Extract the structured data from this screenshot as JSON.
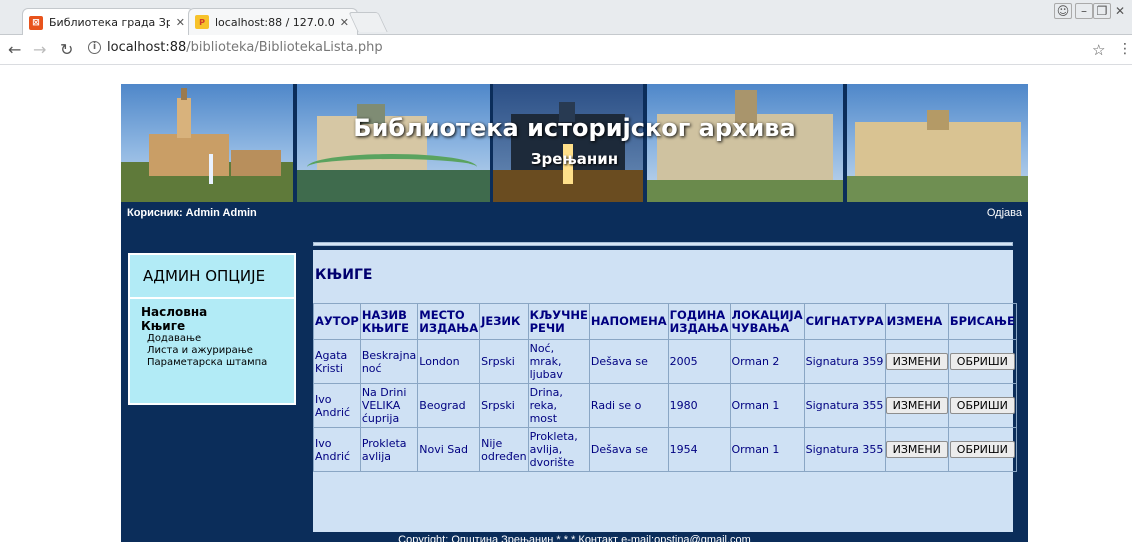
{
  "browser": {
    "tabs": [
      {
        "title": "Библиотека града Зрењ",
        "active": true
      },
      {
        "title": "localhost:88 / 127.0.0.1 /",
        "active": false
      }
    ],
    "url_host": "localhost:88",
    "url_path": "/biblioteka/BibliotekaLista.php"
  },
  "header": {
    "title": "Библиотека историјског архива",
    "subtitle": "Зрењанин"
  },
  "userbar": {
    "user": "Корисник: Admin Admin",
    "logout": "Одјава"
  },
  "sidebar": {
    "heading": "АДМИН ОПЦИЈЕ",
    "main_items": [
      "Насловна",
      "Књиге"
    ],
    "sub_items": [
      "Додавање",
      "Листа и ажурирање",
      "Параметарска штампа"
    ]
  },
  "content": {
    "title": "КЊИГЕ",
    "columns": [
      "АУТОР",
      "НАЗИВ КЊИГЕ",
      "МЕСТО ИЗДАЊА",
      "ЈЕЗИК",
      "КЉУЧНЕ РЕЧИ",
      "НАПОМЕНА",
      "ГОДИНА ИЗДАЊА",
      "ЛОКАЦИЈА ЧУВАЊА",
      "СИГНАТУРА",
      "ИЗМЕНА",
      "БРИСАЊЕ"
    ],
    "rows": [
      {
        "author": "Agata Kristi",
        "title": "Beskrajna noć",
        "place": "London",
        "language": "Srpski",
        "keywords": "Noć, mrak, ljubav",
        "note": "Dešava se",
        "year": "2005",
        "location": "Orman 2",
        "signature": "Signatura 359"
      },
      {
        "author": "Ivo Andrić",
        "title": "Na Drini VELIKA ćuprija",
        "place": "Beograd",
        "language": "Srpski",
        "keywords": "Drina, reka, most",
        "note": "Radi se o",
        "year": "1980",
        "location": "Orman 1",
        "signature": "Signatura 355"
      },
      {
        "author": "Ivo Andrić",
        "title": "Prokleta avlija",
        "place": "Novi Sad",
        "language": "Nije određen",
        "keywords": "Prokleta, avlija, dvorište",
        "note": "Dešava se",
        "year": "1954",
        "location": "Orman 1",
        "signature": "Signatura 355"
      }
    ],
    "edit_label": "ИЗМЕНИ",
    "delete_label": "ОБРИШИ"
  },
  "footer": "Copyright: Општина Зрењанин * * * Контакт e-mail:opstina@gmail.com",
  "colors": {
    "page_bg": "#0b2d5a",
    "sidebar_bg": "#b2ebf6",
    "content_bg": "#cfe1f4",
    "table_text": "#000080"
  }
}
